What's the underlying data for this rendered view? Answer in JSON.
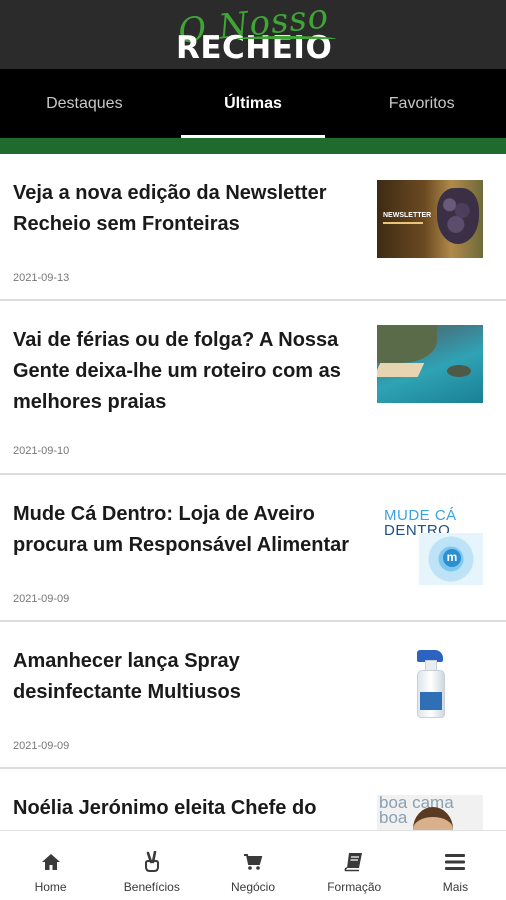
{
  "header": {
    "logo_script": "O Nosso",
    "logo_main": "RECHEIO"
  },
  "tabs": [
    {
      "label": "Destaques",
      "active": false
    },
    {
      "label": "Últimas",
      "active": true
    },
    {
      "label": "Favoritos",
      "active": false
    }
  ],
  "articles": [
    {
      "title": "Veja a nova edição da Newsletter Recheio sem Fronteiras",
      "date": "2021-09-13",
      "thumbnail": "newsletter-grapes-image"
    },
    {
      "title": "Vai de férias ou de folga? A Nossa Gente deixa-lhe um roteiro com as melhores praias",
      "date": "2021-09-10",
      "thumbnail": "beach-coast-image"
    },
    {
      "title": "Mude Cá Dentro: Loja de Aveiro procura um Responsável Alimentar",
      "date": "2021-09-09",
      "thumbnail": "mude-ca-dentro-logo"
    },
    {
      "title": "Amanhecer lança Spray desinfectante Multiusos",
      "date": "2021-09-09",
      "thumbnail": "spray-bottle-image"
    },
    {
      "title": "Noélia Jerónimo eleita Chefe do",
      "date": "",
      "thumbnail": "chef-portrait-image"
    }
  ],
  "thumbnail_text": {
    "newsletter": "NEWSLETTER",
    "mude_line1": "MUDE CÁ",
    "mude_line2": "DENTRO",
    "mude_badge": "m",
    "boa_line1": "boa cama",
    "boa_line2": "boa"
  },
  "bottom_nav": [
    {
      "label": "Home",
      "icon": "home-icon"
    },
    {
      "label": "Benefícios",
      "icon": "peace-hand-icon"
    },
    {
      "label": "Negócio",
      "icon": "cart-icon"
    },
    {
      "label": "Formação",
      "icon": "book-icon"
    },
    {
      "label": "Mais",
      "icon": "menu-icon"
    }
  ],
  "colors": {
    "header": "#2b2b2b",
    "tabs": "#000000",
    "accent_green": "#1f6b2e",
    "logo_green": "#3fa535"
  }
}
